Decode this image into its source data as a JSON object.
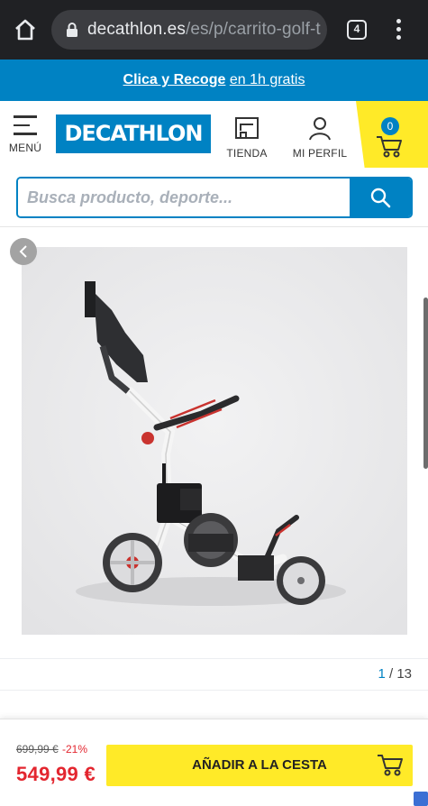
{
  "browser": {
    "url_main": "decathlon.es",
    "url_rest": "/es/p/carrito-golf-t",
    "tab_count": "4"
  },
  "promo": {
    "link_text": "Clica y Recoge",
    "suffix_text": "en 1h gratis"
  },
  "header": {
    "menu_label": "MENÚ",
    "logo_text": "DECATHLON",
    "store_label": "TIENDA",
    "profile_label": "MI PERFIL",
    "cart_count": "0"
  },
  "search": {
    "placeholder": "Busca producto, deporte..."
  },
  "gallery": {
    "current_index": "1",
    "separator": " / ",
    "total": "13"
  },
  "purchase": {
    "old_price": "699,99 €",
    "discount": "-21%",
    "price": "549,99 €",
    "add_to_cart_label": "AÑADIR A LA CESTA"
  },
  "colors": {
    "brand_blue": "#0082c3",
    "accent_yellow": "#ffea28",
    "price_red": "#e3262f"
  }
}
